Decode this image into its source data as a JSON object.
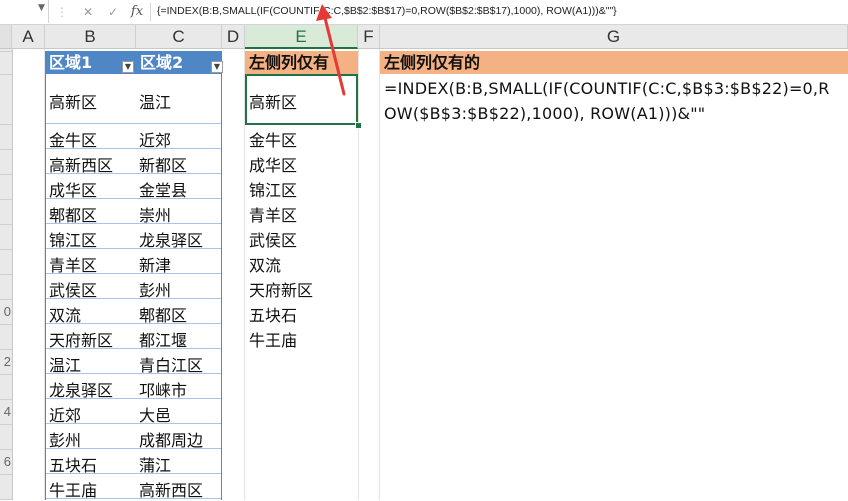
{
  "formula_bar": {
    "cancel_icon": "✕",
    "enter_icon": "✓",
    "fx_label": "fx",
    "formula": "{=INDEX(B:B,SMALL(IF(COUNTIF(C:C,$B$2:$B$17)=0,ROW($B$2:$B$17),1000), ROW(A1)))&\"\"}"
  },
  "columns": [
    "A",
    "B",
    "C",
    "D",
    "E",
    "F",
    "G"
  ],
  "row_numbers": [
    "",
    "",
    "",
    "",
    "",
    "",
    "",
    "",
    "",
    "0",
    "",
    "2",
    "",
    "4",
    "",
    "6",
    "",
    ""
  ],
  "table": {
    "header_b": "区域1",
    "header_c": "区域2",
    "rows": [
      [
        "高新区",
        "温江"
      ],
      [
        "金牛区",
        "近郊"
      ],
      [
        "高新西区",
        "新都区"
      ],
      [
        "成华区",
        "金堂县"
      ],
      [
        "郫都区",
        "崇州"
      ],
      [
        "锦江区",
        "龙泉驿区"
      ],
      [
        "青羊区",
        "新津"
      ],
      [
        "武侯区",
        "彭州"
      ],
      [
        "双流",
        "郫都区"
      ],
      [
        "天府新区",
        "都江堰"
      ],
      [
        "温江",
        "青白江区"
      ],
      [
        "龙泉驿区",
        "邛崃市"
      ],
      [
        "近郊",
        "大邑"
      ],
      [
        "彭州",
        "成都周边"
      ],
      [
        "五块石",
        "蒲江"
      ],
      [
        "牛王庙",
        "高新西区"
      ]
    ]
  },
  "result": {
    "header": "左侧列仅有",
    "values": [
      "高新区",
      "金牛区",
      "成华区",
      "锦江区",
      "青羊区",
      "武侯区",
      "双流",
      "天府新区",
      "五块石",
      "牛王庙"
    ]
  },
  "notes": {
    "header": "左侧列仅有的",
    "formula_line1": "=INDEX(B:B,SMALL(IF(COUNTIF(C:C,$B$3:$B$22)=0,R",
    "formula_line2": "OW($B$3:$B$22),1000), ROW(A1)))&\"\""
  },
  "colors": {
    "table_header": "#4f86c6",
    "highlight_header": "#f4b183",
    "selection": "#217346",
    "annotation_arrow": "#e53935"
  }
}
